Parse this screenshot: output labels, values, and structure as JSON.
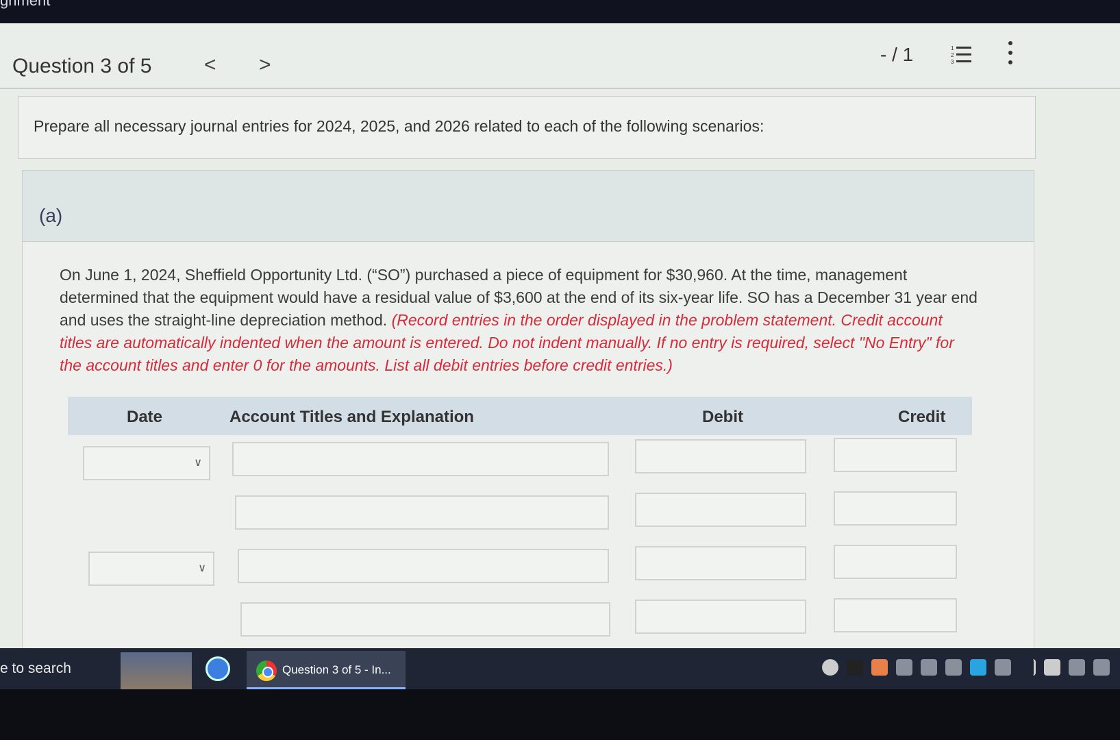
{
  "page_fragment": "gnment",
  "header": {
    "question_label": "Question 3 of 5",
    "prev_glyph": "<",
    "next_glyph": ">",
    "score": "- / 1",
    "list_icon": "numbered-list-icon",
    "more_icon": "more-vertical-icon"
  },
  "prompt": "Prepare all necessary journal entries for 2024, 2025, and 2026 related to each of the following scenarios:",
  "part": {
    "label": "(a)",
    "description": "On June 1, 2024, Sheffield Opportunity Ltd. (“SO”) purchased a piece of equipment for $30,960. At the time, management determined that the equipment would have a residual value of $3,600 at the end of its six-year life. SO has a December 31 year end and uses the straight-line depreciation method. ",
    "instructions": "(Record entries in the order displayed in the problem statement. Credit account titles are automatically indented when the amount is entered. Do not indent manually. If no entry is required, select \"No Entry\" for the account titles and enter 0 for the amounts. List all debit entries before credit entries.)"
  },
  "journal": {
    "columns": [
      "Date",
      "Account Titles and Explanation",
      "Debit",
      "Credit"
    ],
    "rows": [
      {
        "date": "",
        "account": "",
        "debit": "",
        "credit": ""
      },
      {
        "account": "",
        "debit": "",
        "credit": ""
      },
      {
        "date": "",
        "account": "",
        "debit": "",
        "credit": ""
      },
      {
        "account": "",
        "debit": "",
        "credit": ""
      }
    ]
  },
  "taskbar": {
    "search_text": "e to search",
    "active_window": "Question 3 of 5 - In..."
  },
  "colors": {
    "instruction_red": "#d52b3a",
    "header_row_bg": "#d3dde6"
  }
}
